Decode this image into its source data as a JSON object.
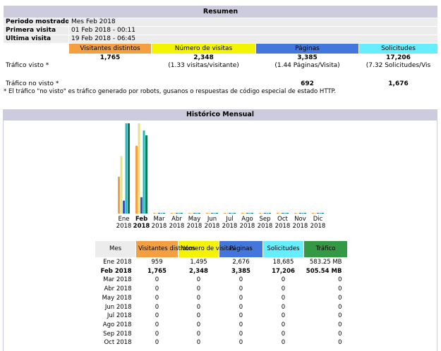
{
  "summary": {
    "title": "Resumen",
    "period_label": "Periodo mostrado",
    "period_value": "Mes Feb 2018",
    "first_label": "Primera visita",
    "first_value": "01 Feb 2018 - 00:11",
    "last_label": "Última visita",
    "last_value": "19 Feb 2018 - 06:45",
    "columns": {
      "visitors": "Visitantes distintos",
      "visits": "Número de visitas",
      "pages": "Páginas",
      "requests": "Solicitudes"
    },
    "seen": {
      "label": "Tráfico visto *",
      "visitors": "1,765",
      "visits": "2,348",
      "visits_sub": "(1.33 visitas/visitante)",
      "pages": "3,385",
      "pages_sub": "(1.44 Páginas/Visita)",
      "requests": "17,206",
      "requests_sub": "(7.32 Solicitudes/Vis"
    },
    "unseen": {
      "label": "Tráfico no visto *",
      "pages": "692",
      "requests": "1,676"
    },
    "note": "* El tráfico \"no visto\" es tráfico generado por robots, gusanos o respuestas de código especial de estado HTTP."
  },
  "history": {
    "title": "Histórico Mensual",
    "headers": {
      "month": "Mes",
      "visitors": "Visitantes distintos",
      "visits": "Número de visitas",
      "pages": "Páginas",
      "requests": "Solicitudes",
      "traffic": "Tráfico"
    },
    "rows": [
      {
        "month": "Ene 2018",
        "visitors": "959",
        "visits": "1,495",
        "pages": "2,676",
        "requests": "18,685",
        "traffic": "583.25 MB"
      },
      {
        "month": "Feb 2018",
        "visitors": "1,765",
        "visits": "2,348",
        "pages": "3,385",
        "requests": "17,206",
        "traffic": "505.54 MB"
      },
      {
        "month": "Mar 2018",
        "visitors": "0",
        "visits": "0",
        "pages": "0",
        "requests": "0",
        "traffic": "0"
      },
      {
        "month": "Abr 2018",
        "visitors": "0",
        "visits": "0",
        "pages": "0",
        "requests": "0",
        "traffic": "0"
      },
      {
        "month": "May 2018",
        "visitors": "0",
        "visits": "0",
        "pages": "0",
        "requests": "0",
        "traffic": "0"
      },
      {
        "month": "Jun 2018",
        "visitors": "0",
        "visits": "0",
        "pages": "0",
        "requests": "0",
        "traffic": "0"
      },
      {
        "month": "Jul 2018",
        "visitors": "0",
        "visits": "0",
        "pages": "0",
        "requests": "0",
        "traffic": "0"
      },
      {
        "month": "Ago 2018",
        "visitors": "0",
        "visits": "0",
        "pages": "0",
        "requests": "0",
        "traffic": "0"
      },
      {
        "month": "Sep 2018",
        "visitors": "0",
        "visits": "0",
        "pages": "0",
        "requests": "0",
        "traffic": "0"
      },
      {
        "month": "Oct 2018",
        "visitors": "0",
        "visits": "0",
        "pages": "0",
        "requests": "0",
        "traffic": "0"
      }
    ],
    "current_month_index": 1
  },
  "chart_data": {
    "type": "bar",
    "categories": [
      {
        "month": "Ene",
        "year": "2018"
      },
      {
        "month": "Feb",
        "year": "2018"
      },
      {
        "month": "Mar",
        "year": "2018"
      },
      {
        "month": "Abr",
        "year": "2018"
      },
      {
        "month": "May",
        "year": "2018"
      },
      {
        "month": "Jun",
        "year": "2018"
      },
      {
        "month": "Jul",
        "year": "2018"
      },
      {
        "month": "Ago",
        "year": "2018"
      },
      {
        "month": "Sep",
        "year": "2018"
      },
      {
        "month": "Oct",
        "year": "2018"
      },
      {
        "month": "Nov",
        "year": "2018"
      },
      {
        "month": "Dic",
        "year": "2018"
      }
    ],
    "current_index": 1,
    "series": [
      {
        "key": "visitors",
        "color": "#f4a040",
        "values": [
          959,
          1765,
          0,
          0,
          0,
          0,
          0,
          0,
          0,
          0,
          0,
          0
        ]
      },
      {
        "key": "visits",
        "color": "#e8e08a",
        "values": [
          1495,
          2348,
          0,
          0,
          0,
          0,
          0,
          0,
          0,
          0,
          0,
          0
        ]
      },
      {
        "key": "pages",
        "color": "#3355cc",
        "values": [
          2676,
          3385,
          0,
          0,
          0,
          0,
          0,
          0,
          0,
          0,
          0,
          0
        ]
      },
      {
        "key": "requests",
        "color": "#22bbbb",
        "values": [
          18685,
          17206,
          0,
          0,
          0,
          0,
          0,
          0,
          0,
          0,
          0,
          0
        ]
      },
      {
        "key": "traffic",
        "color": "#117755",
        "values": [
          583.25,
          505.54,
          0,
          0,
          0,
          0,
          0,
          0,
          0,
          0,
          0,
          0
        ]
      }
    ],
    "scale_groups": [
      [
        "visitors",
        "visits"
      ],
      [
        "pages",
        "requests"
      ],
      [
        "traffic"
      ]
    ]
  }
}
